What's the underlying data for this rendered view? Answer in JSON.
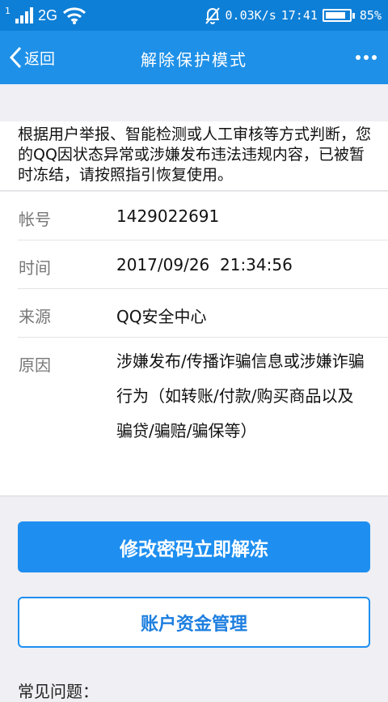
{
  "status_bar": {
    "sim_number": "1",
    "network_type": "2G",
    "speed": "0.03K/s",
    "time": "17:41",
    "battery_percent": "85%",
    "battery_level": 0.85
  },
  "nav": {
    "back_label": "返回",
    "title": "解除保护模式"
  },
  "notice": {
    "text": "根据用户举报、智能检测或人工审核等方式判断，您的QQ因状态异常或涉嫌发布违法违规内容，已被暂时冻结，请按照指引恢复使用。"
  },
  "info": {
    "account_label": "帐号",
    "account_value": "1429022691",
    "time_label": "时间",
    "time_value": "2017/09/26  21:34:56",
    "source_label": "来源",
    "source_value": "QQ安全中心",
    "reason_label": "原因",
    "reason_value": "涉嫌发布/传播诈骗信息或涉嫌诈骗行为（如转账/付款/购买商品以及骗贷/骗赔/骗保等）"
  },
  "buttons": {
    "primary": "修改密码立即解冻",
    "secondary": "账户资金管理"
  },
  "faq": {
    "label": "常见问题："
  },
  "colors": {
    "status_bar": "#0e7fd6",
    "nav_bar": "#1e90e8",
    "primary_button": "#1e8ff0"
  }
}
